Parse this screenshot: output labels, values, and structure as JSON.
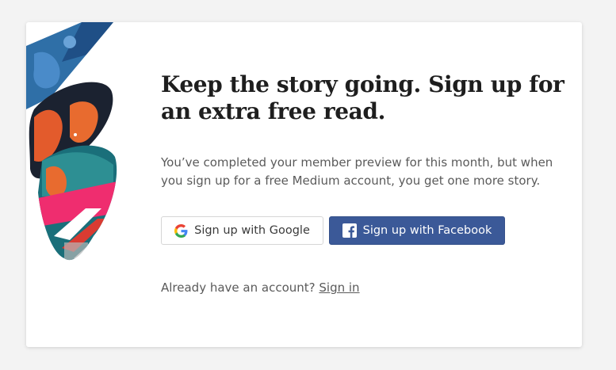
{
  "modal": {
    "title": "Keep the story going. Sign up for an extra free read.",
    "body": "You’ve completed your member preview for this month, but when you sign up for a free Medium account, you get one more story.",
    "google_button_label": "Sign up with Google",
    "google_icon": "google-icon",
    "facebook_button_label": "Sign up with Facebook",
    "facebook_icon": "facebook-icon",
    "signin_prompt": "Already have an account?",
    "signin_link": "Sign in"
  },
  "colors": {
    "facebook_blue": "#3b5998",
    "title_text": "#1e1e1e",
    "body_text": "#5a5a5a"
  }
}
